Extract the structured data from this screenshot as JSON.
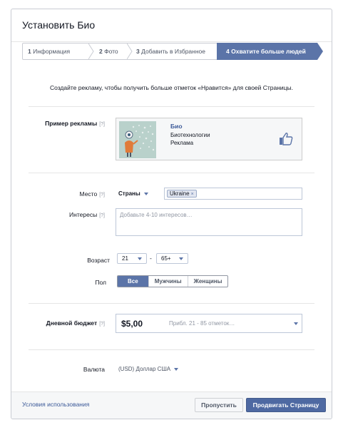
{
  "dialog": {
    "title": "Установить Био"
  },
  "steps": [
    {
      "num": "1",
      "label": "Информация",
      "active": false
    },
    {
      "num": "2",
      "label": "Фото",
      "active": false
    },
    {
      "num": "3",
      "label": "Добавить в Избранное",
      "active": false
    },
    {
      "num": "4",
      "label": "Охватите больше людей",
      "active": true
    }
  ],
  "intro": "Создайте рекламу, чтобы получить больше отметок «Нравится» для своей Страницы.",
  "help_mark": "[?]",
  "ad_preview": {
    "label": "Пример рекламы",
    "page_name": "Био",
    "category": "Биотехнологии",
    "type": "Реклама",
    "like_icon": "thumbs-up-icon"
  },
  "location": {
    "label": "Место",
    "scope": "Страны",
    "tokens": [
      "Ukraine"
    ],
    "remove_glyph": "×"
  },
  "interests": {
    "label": "Интересы",
    "placeholder": "Добавьте 4-10 интересов…"
  },
  "age": {
    "label": "Возраст",
    "min": "21",
    "max": "65+",
    "separator": "-"
  },
  "gender": {
    "label": "Пол",
    "options": [
      "Все",
      "Мужчины",
      "Женщины"
    ],
    "selected": "Все"
  },
  "budget": {
    "label": "Дневной бюджет",
    "amount": "$5,00",
    "estimate": "Прибл. 21 - 85 отметок…"
  },
  "currency": {
    "label": "Валюта",
    "value": "(USD) Доллар США"
  },
  "footer": {
    "terms": "Условия использования",
    "skip": "Пропустить",
    "promote": "Продвигать Страницу"
  },
  "colors": {
    "accent": "#5b74a8",
    "primary_button": "#4e69a2",
    "link": "#3b5998"
  }
}
